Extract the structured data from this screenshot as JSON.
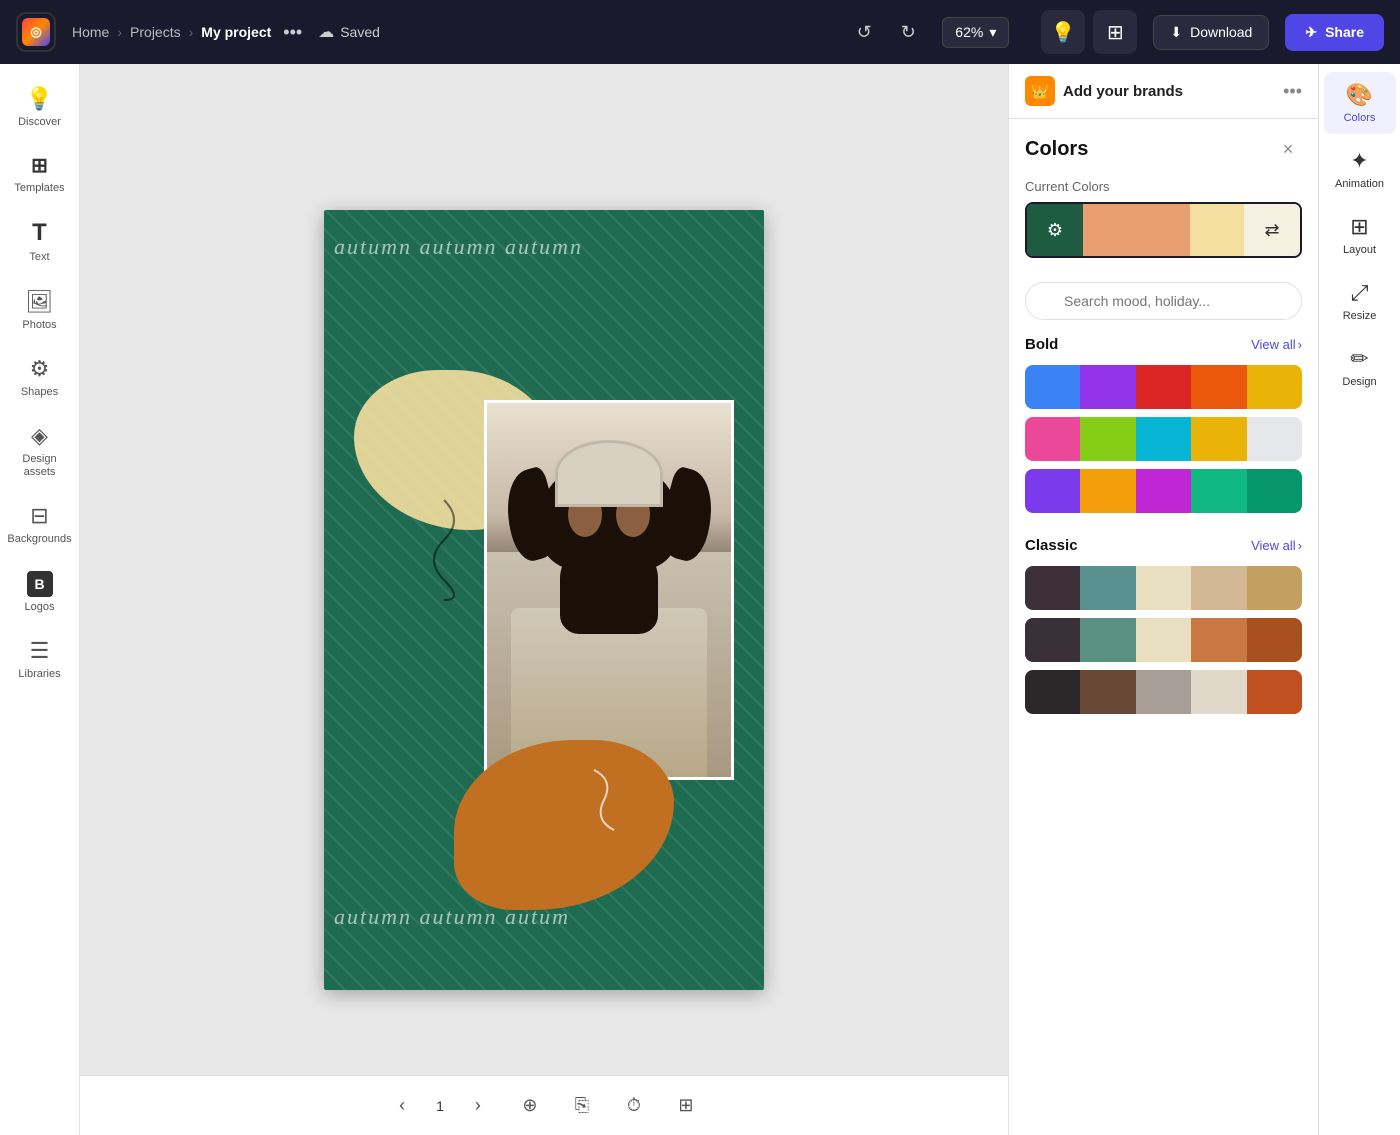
{
  "topbar": {
    "logo_symbol": "◎",
    "nav_home": "Home",
    "nav_projects": "Projects",
    "nav_current": "My project",
    "nav_dots": "•••",
    "saved_label": "Saved",
    "zoom_level": "62%",
    "zoom_arrow": "▾",
    "download_label": "Download",
    "share_label": "Share"
  },
  "sidebar": {
    "items": [
      {
        "id": "discover",
        "icon": "💡",
        "label": "Discover"
      },
      {
        "id": "templates",
        "icon": "⊞",
        "label": "Templates"
      },
      {
        "id": "text",
        "icon": "T",
        "label": "Text"
      },
      {
        "id": "photos",
        "icon": "🖼",
        "label": "Photos"
      },
      {
        "id": "shapes",
        "icon": "⚙",
        "label": "Shapes"
      },
      {
        "id": "design-assets",
        "icon": "◈",
        "label": "Design assets"
      },
      {
        "id": "backgrounds",
        "icon": "⊟",
        "label": "Backgrounds"
      },
      {
        "id": "logos",
        "icon": "B",
        "label": "Logos"
      },
      {
        "id": "libraries",
        "icon": "☰",
        "label": "Libraries"
      }
    ]
  },
  "canvas": {
    "text_top": "autumn autumn autumn",
    "text_bottom": "autumn autumn autum"
  },
  "bottom_toolbar": {
    "page_number": "1"
  },
  "right_panel": {
    "brand_title": "Add your brands",
    "more_dots": "•••",
    "colors_title": "Colors",
    "close_label": "×",
    "current_colors_label": "Current Colors",
    "search_placeholder": "Search mood, holiday...",
    "bold_section": "Bold",
    "bold_view_all": "View all",
    "classic_section": "Classic",
    "classic_view_all": "View all",
    "bold_palettes": [
      [
        "#3b82f6",
        "#9333ea",
        "#dc2626",
        "#ea580c",
        "#eab308"
      ],
      [
        "#ec4899",
        "#84cc16",
        "#06b6d4",
        "#eab308",
        "#e5e7eb"
      ],
      [
        "#7c3aed",
        "#f59e0b",
        "#c026d3",
        "#10b981",
        "#10b981"
      ]
    ],
    "classic_palettes": [
      [
        "#3d3038",
        "#5a9090",
        "#e8dfc0",
        "#d4b896",
        "#c4a060"
      ],
      [
        "#3a3038",
        "#5a9080",
        "#e8dfc0",
        "#c87840",
        "#a85020"
      ],
      [
        "#2a2828",
        "#6a4838",
        "#a8a098",
        "#e0d8c8",
        "#c05020"
      ]
    ],
    "current_colors": [
      "#1e6b52",
      "#e8a070",
      "#f5dfa0",
      "#e8e0c0"
    ]
  },
  "far_right": {
    "items": [
      {
        "id": "colors",
        "icon": "🎨",
        "label": "Colors",
        "active": true
      },
      {
        "id": "animation",
        "icon": "✦",
        "label": "Animation"
      },
      {
        "id": "layout",
        "icon": "⊞",
        "label": "Layout"
      },
      {
        "id": "resize",
        "icon": "⤢",
        "label": "Resize"
      },
      {
        "id": "design",
        "icon": "✏",
        "label": "Design"
      }
    ]
  }
}
